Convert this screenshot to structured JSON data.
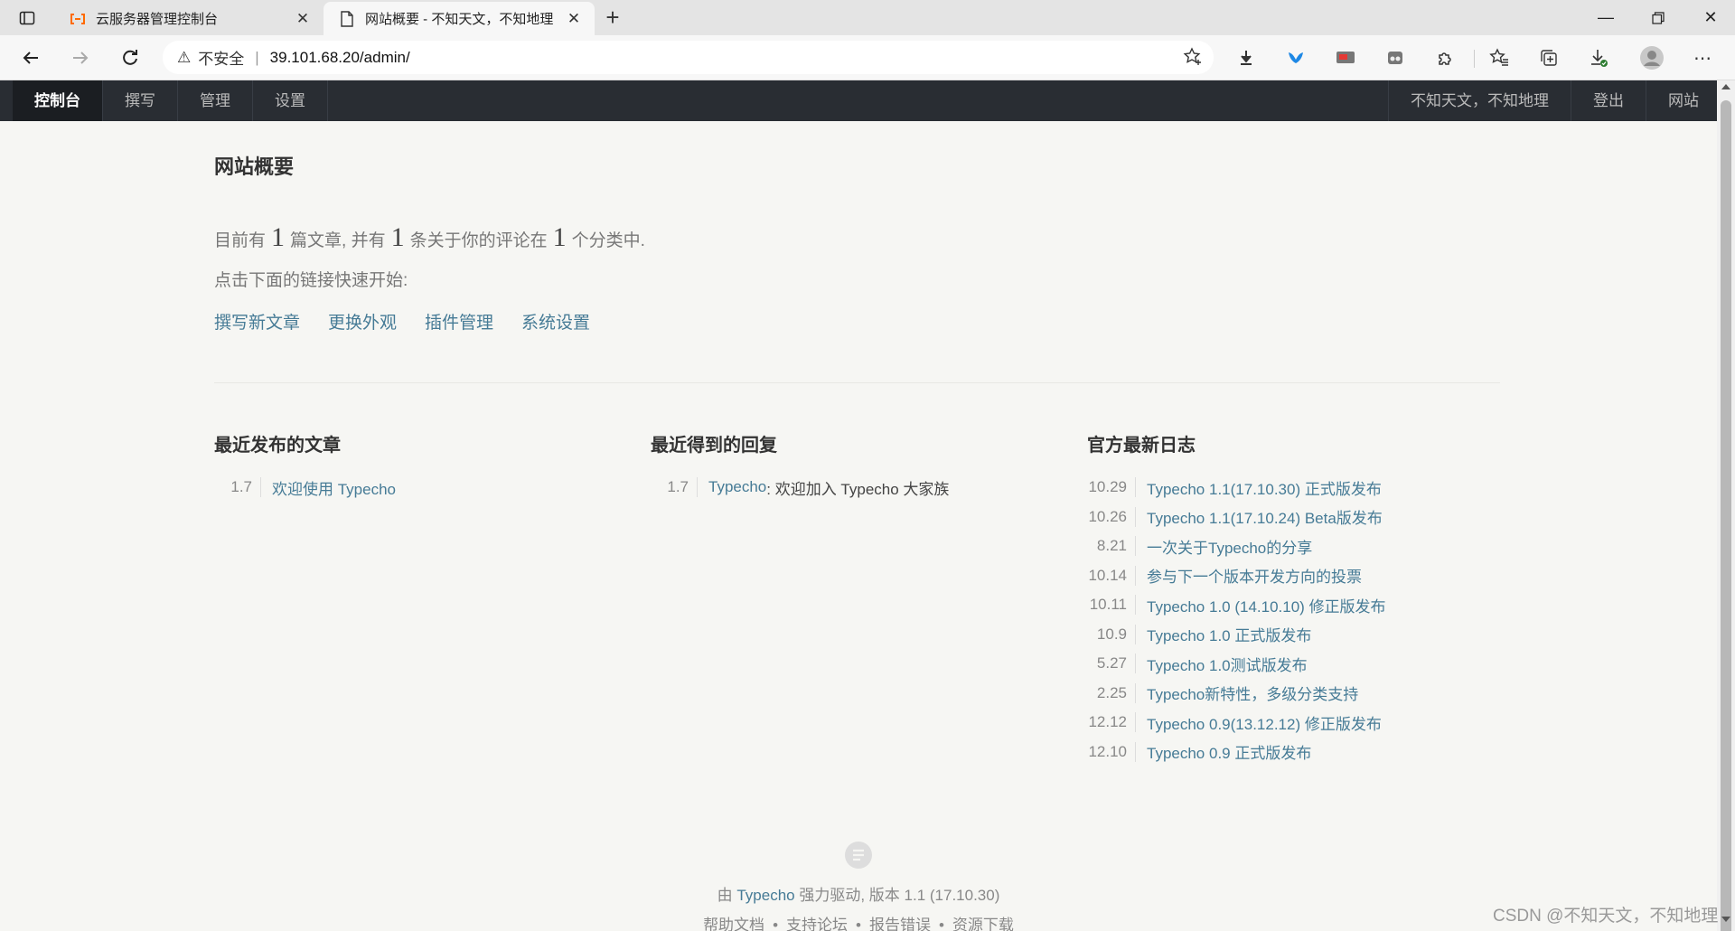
{
  "browser": {
    "tabs": [
      {
        "title": "云服务器管理控制台",
        "active": false,
        "icon": "aliyun-icon"
      },
      {
        "title": "网站概要 - 不知天文，不知地理",
        "active": true,
        "icon": "page-icon"
      }
    ],
    "security_label": "不安全",
    "url": "39.101.68.20/admin/"
  },
  "admin_menu": {
    "items": [
      "控制台",
      "撰写",
      "管理",
      "设置"
    ],
    "active": "控制台",
    "user": "不知天文，不知地理",
    "logout": "登出",
    "site": "网站"
  },
  "overview": {
    "title": "网站概要",
    "stats_prefix": "目前有",
    "posts_count": "1",
    "posts_text": "篇文章, 并有",
    "comments_count": "1",
    "comments_text": "条关于你的评论在",
    "categories_count": "1",
    "categories_text": "个分类中.",
    "hint": "点击下面的链接快速开始:",
    "quick_links": [
      "撰写新文章",
      "更换外观",
      "插件管理",
      "系统设置"
    ]
  },
  "recent_posts": {
    "title": "最近发布的文章",
    "items": [
      {
        "date": "1.7",
        "title": "欢迎使用 Typecho"
      }
    ]
  },
  "recent_replies": {
    "title": "最近得到的回复",
    "items": [
      {
        "date": "1.7",
        "author": "Typecho",
        "text": ": 欢迎加入 Typecho 大家族"
      }
    ]
  },
  "official_news": {
    "title": "官方最新日志",
    "items": [
      {
        "date": "10.29",
        "title": "Typecho 1.1(17.10.30) 正式版发布"
      },
      {
        "date": "10.26",
        "title": "Typecho 1.1(17.10.24) Beta版发布"
      },
      {
        "date": "8.21",
        "title": "一次关于Typecho的分享"
      },
      {
        "date": "10.14",
        "title": "参与下一个版本开发方向的投票"
      },
      {
        "date": "10.11",
        "title": "Typecho 1.0 (14.10.10) 修正版发布"
      },
      {
        "date": "10.9",
        "title": "Typecho 1.0 正式版发布"
      },
      {
        "date": "5.27",
        "title": "Typecho 1.0测试版发布"
      },
      {
        "date": "2.25",
        "title": "Typecho新特性，多级分类支持"
      },
      {
        "date": "12.12",
        "title": "Typecho 0.9(13.12.12) 修正版发布"
      },
      {
        "date": "12.10",
        "title": "Typecho 0.9 正式版发布"
      }
    ]
  },
  "footer": {
    "powered_prefix": "由",
    "powered_link": "Typecho",
    "powered_suffix": "强力驱动, 版本 1.1 (17.10.30)",
    "links": [
      "帮助文档",
      "支持论坛",
      "报告错误",
      "资源下载"
    ]
  },
  "watermark": "CSDN @不知天文，不知地理",
  "colors": {
    "link": "#467b96",
    "admin_bar": "#292d33",
    "background": "#f6f6f3"
  }
}
